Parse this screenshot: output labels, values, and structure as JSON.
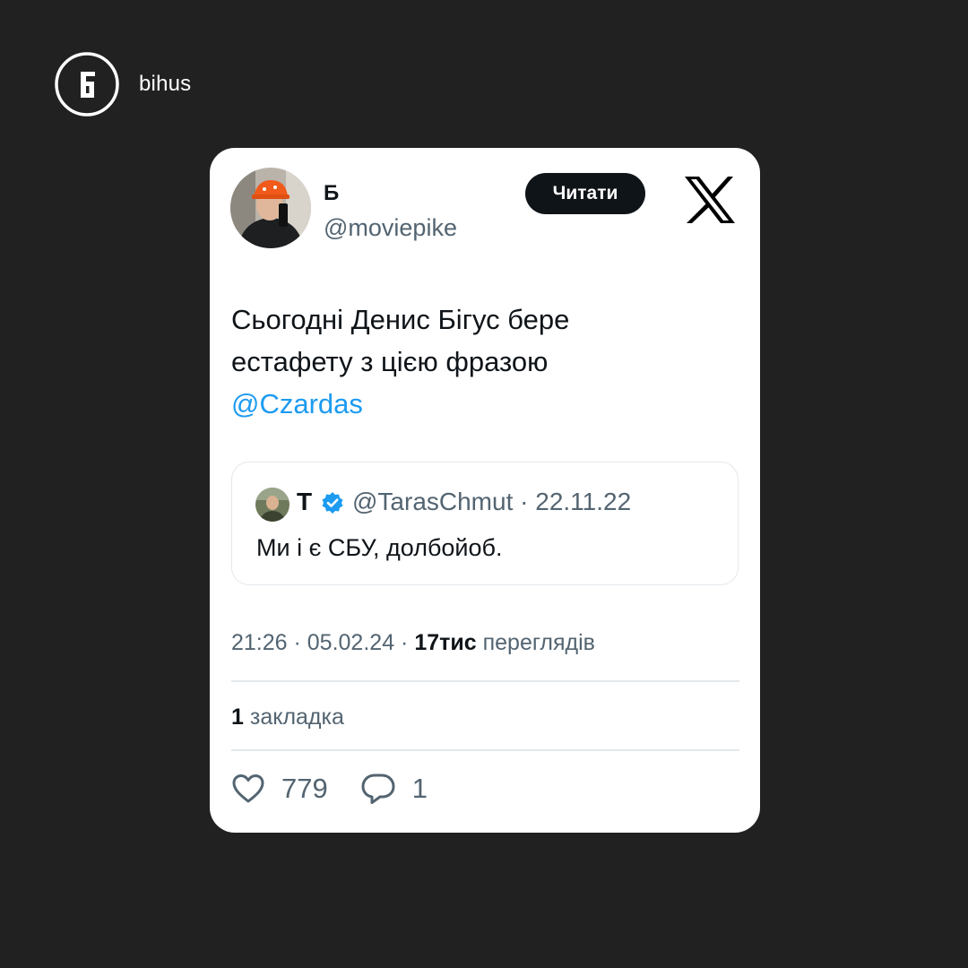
{
  "brand": {
    "name": "bihus",
    "logo_icon": "bihus-b-logo-icon"
  },
  "tweet": {
    "author": {
      "name": "Б",
      "handle": "@moviepike"
    },
    "read_button_label": "Читати",
    "text_line1": "Сьогодні Денис Бігус бере",
    "text_line2": "естафету з цією фразою",
    "mention": "@Czardas",
    "quoted": {
      "name": "Т",
      "handle_date": "@TarasChmut · 22.11.22",
      "text": "Ми і є СБУ, долбойоб."
    },
    "meta": {
      "time_date": "21:26 · 05.02.24 · ",
      "views_count": "17тис",
      "views_label": "переглядів"
    },
    "bookmarks": {
      "count": "1",
      "label": "закладка"
    },
    "likes_count": "779",
    "replies_count": "1"
  },
  "colors": {
    "background": "#212121",
    "card": "#ffffff",
    "text_primary": "#0f1419",
    "text_secondary": "#536471",
    "link": "#1d9bf0"
  }
}
